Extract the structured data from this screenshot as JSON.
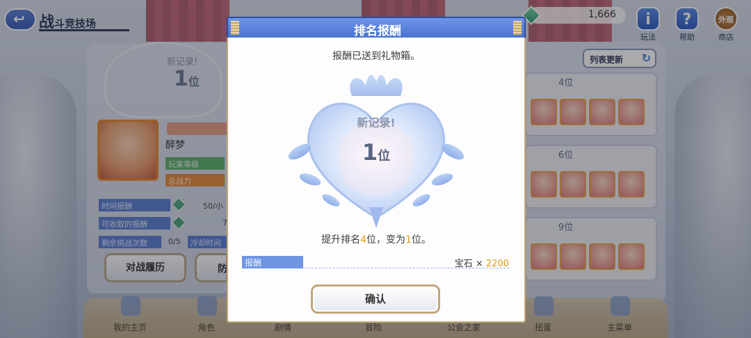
{
  "header": {
    "title_main": "战",
    "title_rest": "斗竞技场",
    "coins": "1,666"
  },
  "top_icons": [
    {
      "glyph": "i",
      "label": "玩法"
    },
    {
      "glyph": "?",
      "label": "帮助"
    },
    {
      "glyph": "外观",
      "label": "商店"
    }
  ],
  "left_panel": {
    "record_label": "新记录!",
    "record_rank": "1",
    "record_unit": "位",
    "player_name": "醉梦",
    "level_label": "玩家等级",
    "power_label": "总战力",
    "stats": [
      {
        "label": "时间报酬",
        "value": "50/小"
      },
      {
        "label": "可收取的报酬",
        "value": "7"
      },
      {
        "label": "剩余挑战次数",
        "value": "0/5"
      }
    ],
    "cooldown_label": "冷却时间",
    "history_button": "对战履历",
    "defense_button": "防"
  },
  "right_panel": {
    "refresh_button": "列表更新",
    "opponents": [
      {
        "rank": "4位"
      },
      {
        "rank": "6位"
      },
      {
        "rank": "9位"
      }
    ]
  },
  "bottom_nav": [
    {
      "label": "我的主页"
    },
    {
      "label": "角色"
    },
    {
      "label": "剧情"
    },
    {
      "label": "冒险"
    },
    {
      "label": "公会之家"
    },
    {
      "label": "扭蛋"
    },
    {
      "label": "主菜单"
    }
  ],
  "modal": {
    "title": "排名报酬",
    "sent_message": "报酬已送到礼物箱。",
    "new_record": "新记录!",
    "rank_number": "1",
    "rank_unit": "位",
    "improve_prefix": "提升排名",
    "improve_up": "4",
    "improve_mid": "位，变为",
    "improve_new": "1",
    "improve_suffix": "位。",
    "reward_label": "报酬",
    "reward_item": "宝石",
    "reward_times": "×",
    "reward_amount": "2200",
    "confirm_button": "确认"
  },
  "colors": {
    "accent_blue": "#4a73cf",
    "highlight_orange": "#e39a1b",
    "button_border": "#c2a57c"
  }
}
